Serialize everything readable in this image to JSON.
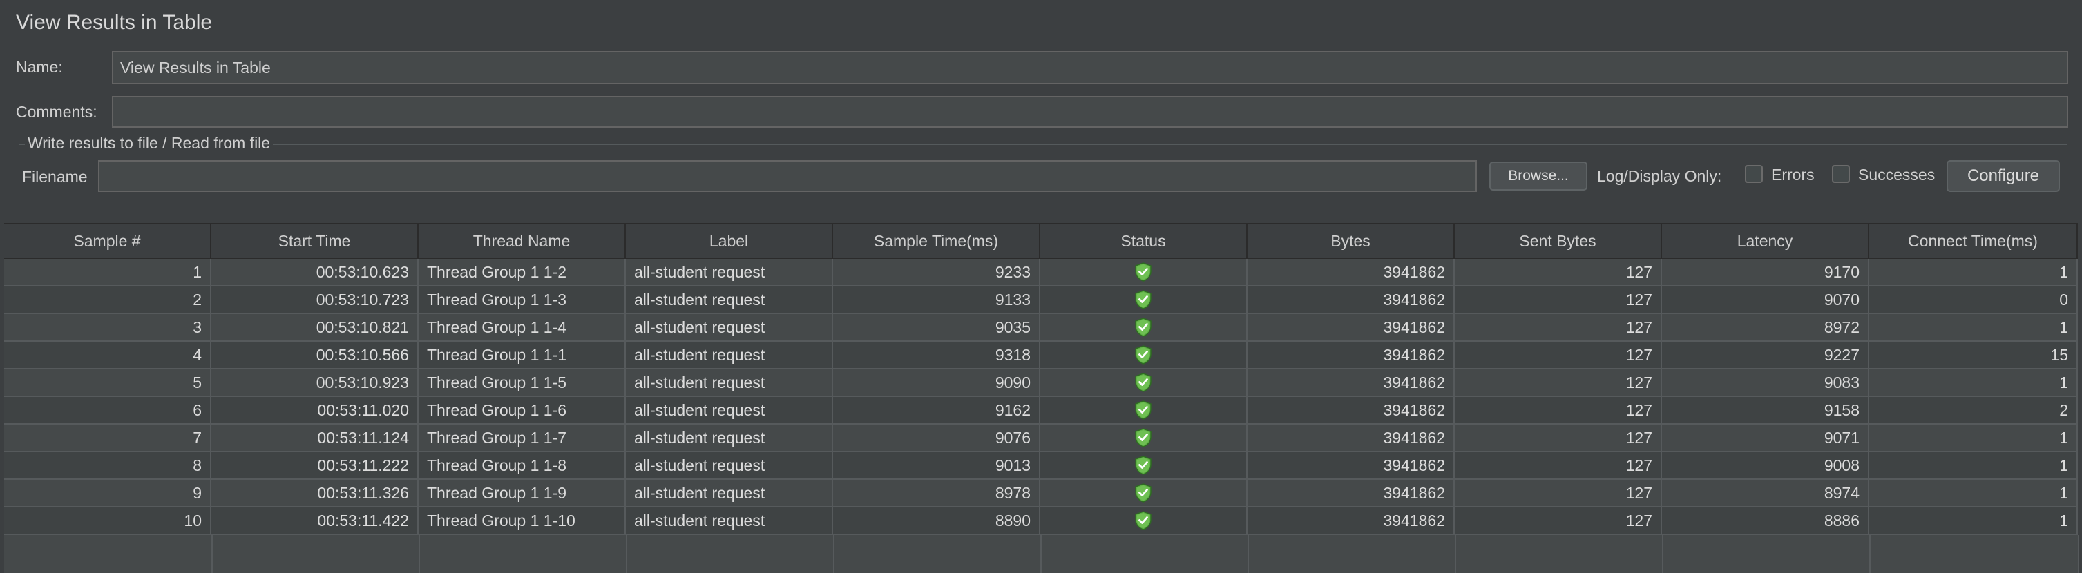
{
  "window": {
    "title": "View Results in Table"
  },
  "form": {
    "name_label": "Name:",
    "name_value": "View Results in Table",
    "comments_label": "Comments:",
    "comments_value": "",
    "group_title": "Write results to file / Read from file",
    "filename_label": "Filename",
    "filename_value": "",
    "browse_label": "Browse...",
    "log_display_label": "Log/Display Only:",
    "errors_label": "Errors",
    "errors_checked": false,
    "successes_label": "Successes",
    "successes_checked": false,
    "configure_label": "Configure"
  },
  "table": {
    "columns": [
      "Sample #",
      "Start Time",
      "Thread Name",
      "Label",
      "Sample Time(ms)",
      "Status",
      "Bytes",
      "Sent Bytes",
      "Latency",
      "Connect Time(ms)"
    ],
    "rows": [
      [
        "1",
        "00:53:10.623",
        "Thread Group 1 1-2",
        "all-student request",
        "9233",
        "success",
        "3941862",
        "127",
        "9170",
        "1"
      ],
      [
        "2",
        "00:53:10.723",
        "Thread Group 1 1-3",
        "all-student request",
        "9133",
        "success",
        "3941862",
        "127",
        "9070",
        "0"
      ],
      [
        "3",
        "00:53:10.821",
        "Thread Group 1 1-4",
        "all-student request",
        "9035",
        "success",
        "3941862",
        "127",
        "8972",
        "1"
      ],
      [
        "4",
        "00:53:10.566",
        "Thread Group 1 1-1",
        "all-student request",
        "9318",
        "success",
        "3941862",
        "127",
        "9227",
        "15"
      ],
      [
        "5",
        "00:53:10.923",
        "Thread Group 1 1-5",
        "all-student request",
        "9090",
        "success",
        "3941862",
        "127",
        "9083",
        "1"
      ],
      [
        "6",
        "00:53:11.020",
        "Thread Group 1 1-6",
        "all-student request",
        "9162",
        "success",
        "3941862",
        "127",
        "9158",
        "2"
      ],
      [
        "7",
        "00:53:11.124",
        "Thread Group 1 1-7",
        "all-student request",
        "9076",
        "success",
        "3941862",
        "127",
        "9071",
        "1"
      ],
      [
        "8",
        "00:53:11.222",
        "Thread Group 1 1-8",
        "all-student request",
        "9013",
        "success",
        "3941862",
        "127",
        "9008",
        "1"
      ],
      [
        "9",
        "00:53:11.326",
        "Thread Group 1 1-9",
        "all-student request",
        "8978",
        "success",
        "3941862",
        "127",
        "8974",
        "1"
      ],
      [
        "10",
        "00:53:11.422",
        "Thread Group 1 1-10",
        "all-student request",
        "8890",
        "success",
        "3941862",
        "127",
        "8886",
        "1"
      ]
    ],
    "status_icon": "green-shield-check-icon"
  },
  "colors": {
    "background": "#3c3f41",
    "field": "#45494a",
    "row_alt": "#3f4344",
    "success": "#5fb146"
  }
}
